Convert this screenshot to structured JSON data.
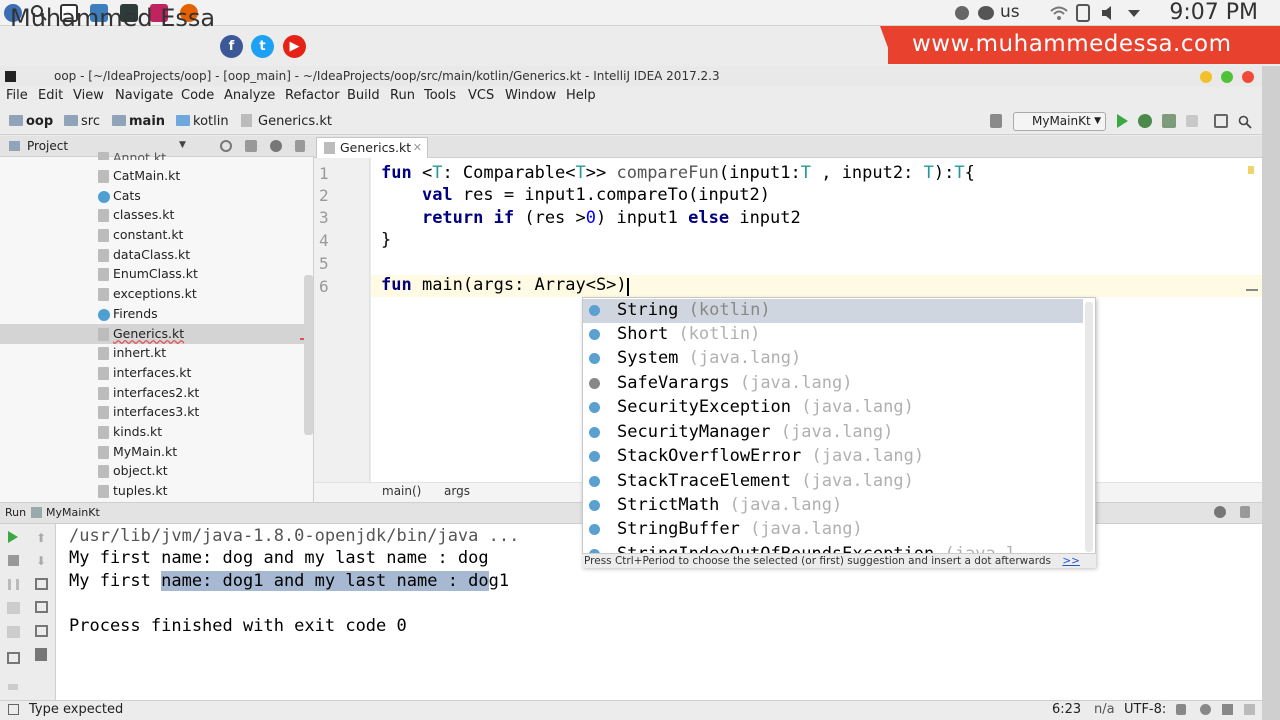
{
  "system": {
    "keyboard": "us",
    "clock": "9:07 PM"
  },
  "banner": {
    "author": "Muhammed Essa",
    "site": "www.muhammedessa.com",
    "colors": {
      "site_bg": "#e8422f",
      "facebook": "#3b5998",
      "twitter": "#1da1f2",
      "youtube": "#e62117"
    }
  },
  "window": {
    "title": "oop - [~/IdeaProjects/oop] - [oop_main] - ~/IdeaProjects/oop/src/main/kotlin/Generics.kt - IntelliJ IDEA 2017.2.3"
  },
  "menu": [
    "File",
    "Edit",
    "View",
    "Navigate",
    "Code",
    "Analyze",
    "Refactor",
    "Build",
    "Run",
    "Tools",
    "VCS",
    "Window",
    "Help"
  ],
  "navbar": {
    "crumbs": [
      "oop",
      "src",
      "main",
      "kotlin",
      "Generics.kt"
    ],
    "run_config": "MyMainKt"
  },
  "project": {
    "header": "Project",
    "partial_top": "Annot.kt",
    "files": [
      "CatMain.kt",
      "Cats",
      "classes.kt",
      "constant.kt",
      "dataClass.kt",
      "EnumClass.kt",
      "exceptions.kt",
      "Firends",
      "Generics.kt",
      "inhert.kt",
      "interfaces.kt",
      "interfaces2.kt",
      "interfaces3.kt",
      "kinds.kt",
      "MyMain.kt",
      "object.kt",
      "tuples.kt"
    ],
    "selected": "Generics.kt"
  },
  "editor": {
    "tab": "Generics.kt",
    "line_numbers": [
      "1",
      "2",
      "3",
      "4",
      "5",
      "6"
    ],
    "lines": {
      "l1a": "fun",
      "l1b": " <",
      "l1c": "T",
      "l1d": ": Comparable<",
      "l1e": "T",
      "l1f": ">> ",
      "l1g": "compareFun",
      "l1h": "(input1:",
      "l1i": "T",
      "l1j": " , input2: ",
      "l1k": "T",
      "l1l": "):",
      "l1m": "T",
      "l1n": "{",
      "l2a": "    ",
      "l2b": "val",
      "l2c": " res = input1.compareTo(input2)",
      "l3a": "    ",
      "l3b": "return",
      "l3c": " ",
      "l3d": "if",
      "l3e": " (res >",
      "l3f": "0",
      "l3g": ") input1 ",
      "l3h": "else",
      "l3i": " input2",
      "l4": "}",
      "l6a": "fun",
      "l6b": " main(args: Array<S>)"
    },
    "breadcrumb": [
      "main()",
      "args"
    ]
  },
  "completion": {
    "items": [
      {
        "name": "String",
        "pkg": "(kotlin)"
      },
      {
        "name": "Short",
        "pkg": "(kotlin)"
      },
      {
        "name": "System",
        "pkg": "(java.lang)"
      },
      {
        "name": "SafeVarargs",
        "pkg": "(java.lang)"
      },
      {
        "name": "SecurityException",
        "pkg": "(java.lang)"
      },
      {
        "name": "SecurityManager",
        "pkg": "(java.lang)"
      },
      {
        "name": "StackOverflowError",
        "pkg": "(java.lang)"
      },
      {
        "name": "StackTraceElement",
        "pkg": "(java.lang)"
      },
      {
        "name": "StrictMath",
        "pkg": "(java.lang)"
      },
      {
        "name": "StringBuffer",
        "pkg": "(java.lang)"
      },
      {
        "name": "StringIndexOutOfBoundsException",
        "pkg": "(java.l"
      }
    ],
    "hint": "Press Ctrl+Period to choose the selected (or first) suggestion and insert a dot afterwards",
    "hint_link": ">>"
  },
  "run": {
    "label": "Run",
    "config": "MyMainKt",
    "console": {
      "cmd": "/usr/lib/jvm/java-1.8.0-openjdk/bin/java ...",
      "out1": "My first name: dog and my last name : dog",
      "out2a": "My first ",
      "out2b": "name: dog1 and my last name : do",
      "out2c": "g1",
      "exit": "Process finished with exit code 0"
    }
  },
  "status": {
    "message": "Type expected",
    "position": "6:23",
    "na": "n/a",
    "encoding": "UTF-8:"
  }
}
